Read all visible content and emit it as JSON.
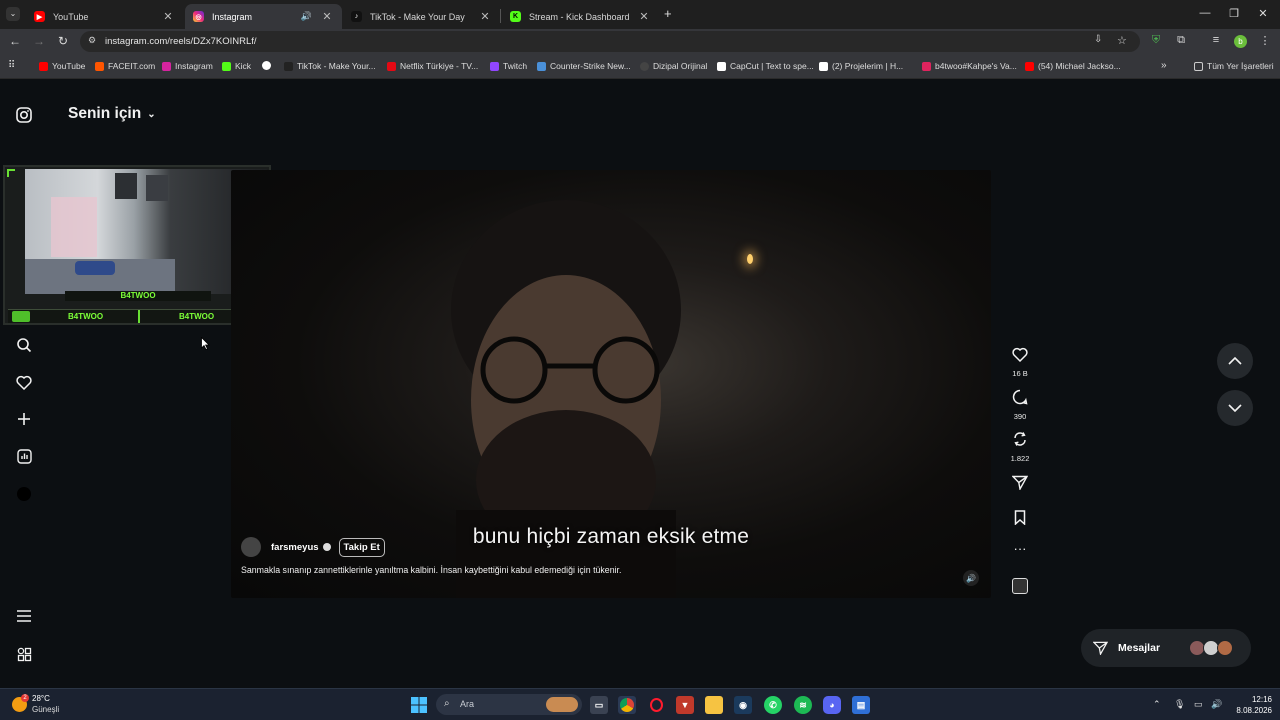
{
  "tabs": [
    {
      "title": "YouTube",
      "color": "#ff0000"
    },
    {
      "title": "Instagram",
      "color": "#d6249f"
    },
    {
      "title": "TikTok - Make Your Day",
      "color": "#000000"
    },
    {
      "title": "Stream - Kick Dashboard",
      "color": "#53fc18"
    }
  ],
  "address": {
    "url": "instagram.com/reels/DZx7KOINRLf/"
  },
  "bookmarks": [
    "YouTube",
    "FACEIT.com",
    "Instagram",
    "Kick",
    "",
    "TikTok - Make Your...",
    "Netflix Türkiye - TV...",
    "Twitch",
    "Counter-Strike New...",
    "Dizipal Orijinal",
    "CapCut | Text to spe...",
    "(2)  Projelerim | H...",
    "b4twoo#Kahpe's Va...",
    "(54) Michael Jackso..."
  ],
  "bookmarks_all": "Tüm Yer İşaretleri",
  "feed": {
    "title": "Senin için"
  },
  "overlay": {
    "nameplate": "B4TWOO",
    "left_tag": "B4TWOO",
    "right_tag": "B4TWOO"
  },
  "reel": {
    "caption": "bunu hiçbi zaman eksik etme",
    "author": "farsmeyus",
    "follow_label": "Takip Et",
    "description": "Sanmakla sınanıp zannettiklerinle yanıltma kalbini. İnsan kaybettiğini kabul edemediği için tükenir.",
    "likes": "16 B",
    "comments": "390",
    "reposts": "1.822"
  },
  "messages": {
    "label": "Mesajlar"
  },
  "taskbar": {
    "search_placeholder": "Ara",
    "temperature": "28°C",
    "condition": "Güneşli",
    "weather_badge": "2",
    "time": "12:16",
    "date": "8.08.2026"
  }
}
